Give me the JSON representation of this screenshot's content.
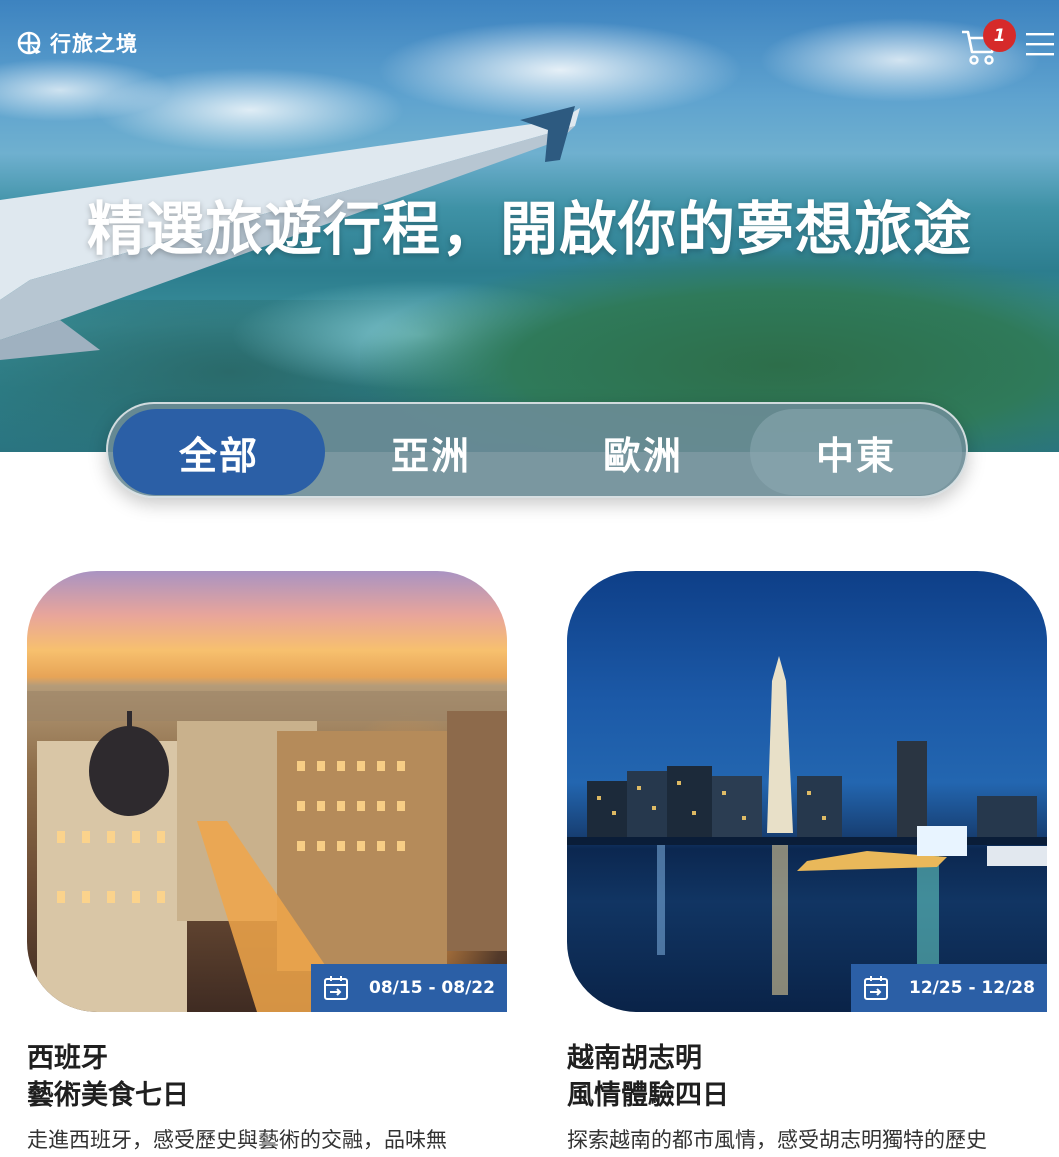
{
  "header": {
    "logo_text": "行旅之境",
    "cart_count": "1"
  },
  "hero": {
    "title": "精選旅遊行程，開啟你的夢想旅途"
  },
  "tabs": [
    {
      "label": "全部",
      "active": true
    },
    {
      "label": "亞洲",
      "active": false
    },
    {
      "label": "歐洲",
      "active": false
    },
    {
      "label": "中東",
      "active": false
    }
  ],
  "cards": [
    {
      "date": "08/15 - 08/22",
      "title_line1": "西班牙",
      "title_line2": "藝術美食七日",
      "desc": "走進西班牙，感受歷史與藝術的交融，品味無"
    },
    {
      "date": "12/25 - 12/28",
      "title_line1": "越南胡志明",
      "title_line2": "風情體驗四日",
      "desc": "探索越南的都市風情，感受胡志明獨特的歷史"
    }
  ],
  "colors": {
    "primary": "#2b5fa6",
    "badge": "#d62a2a"
  }
}
